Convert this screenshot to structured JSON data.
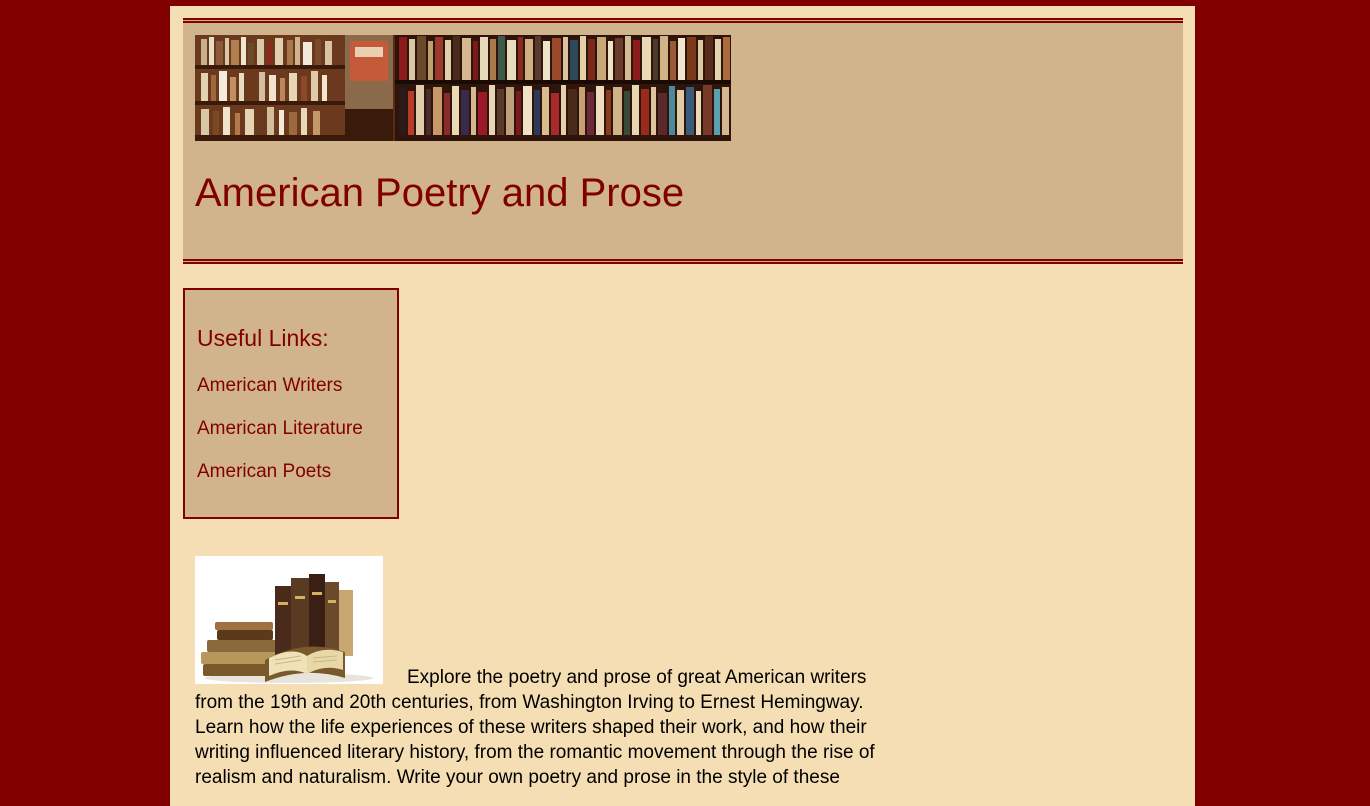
{
  "header": {
    "title": "American Poetry and Prose",
    "banner_image": "bookshelf-banner-image"
  },
  "sidebar": {
    "heading": "Useful Links:",
    "links": [
      {
        "label": "American Writers"
      },
      {
        "label": "American Literature"
      },
      {
        "label": "American Poets"
      }
    ]
  },
  "main": {
    "image": "antique-books-image",
    "intro_text": "Explore the poetry and prose of great American writers from the 19th and 20th centuries, from Washington Irving to Ernest Hemingway. Learn how the life experiences of these writers shaped their work, and how their writing influenced literary history, from the romantic movement through the rise of realism and naturalism. Write your own poetry and prose in the style of these"
  },
  "colors": {
    "background": "#800000",
    "page": "#f5deb3",
    "panel": "#d2b48c",
    "accent": "#800000"
  }
}
